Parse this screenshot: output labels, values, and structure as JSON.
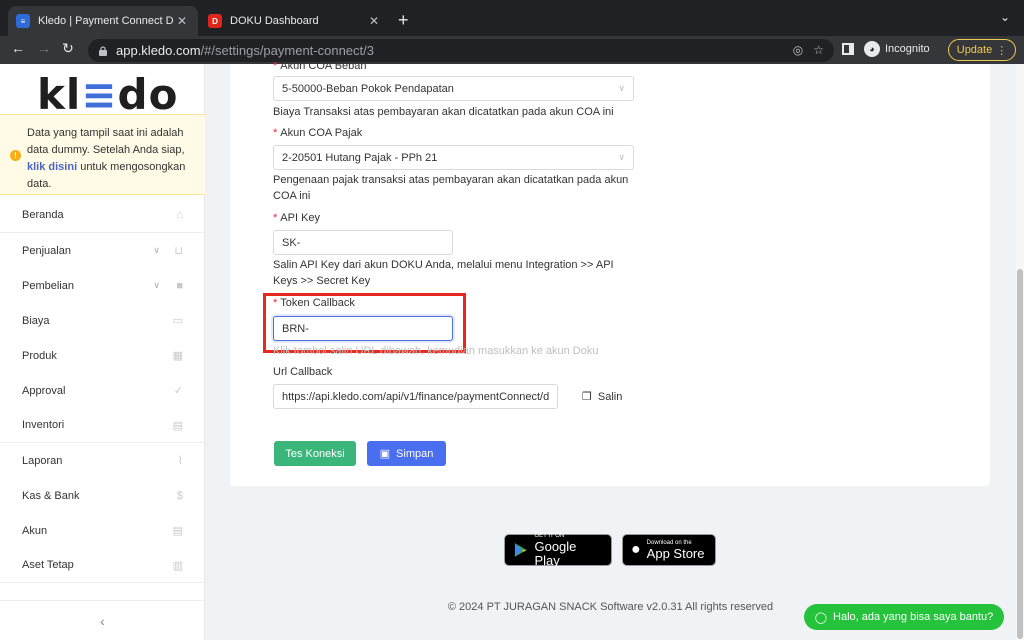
{
  "browser": {
    "tabs": [
      {
        "title": "Kledo | Payment Connect Doku",
        "favicon": "kledo-favicon"
      },
      {
        "title": "DOKU Dashboard",
        "favicon": "doku-favicon"
      }
    ],
    "url_host": "app.kledo.com",
    "url_path": "/#/settings/payment-connect/3",
    "incognito_label": "Incognito",
    "update_label": "Update"
  },
  "sidebar": {
    "logo": "kledo",
    "notice": {
      "text_before": "Data yang tampil saat ini adalah data dummy. Setelah Anda siap, ",
      "link": "klik disini",
      "text_after": " untuk mengosongkan data."
    },
    "items": [
      {
        "label": "Beranda",
        "icon": "home-icon"
      },
      {
        "label": "Penjualan",
        "icon": "basket-icon",
        "expandable": true
      },
      {
        "label": "Pembelian",
        "icon": "bag-icon",
        "expandable": true
      },
      {
        "label": "Biaya",
        "icon": "card-icon"
      },
      {
        "label": "Produk",
        "icon": "box-icon"
      },
      {
        "label": "Approval",
        "icon": "check-icon"
      },
      {
        "label": "Inventori",
        "icon": "warehouse-icon"
      },
      {
        "label": "Laporan",
        "icon": "chart-icon"
      },
      {
        "label": "Kas & Bank",
        "icon": "dollar-icon"
      },
      {
        "label": "Akun",
        "icon": "list-icon"
      },
      {
        "label": "Aset Tetap",
        "icon": "building-icon"
      }
    ]
  },
  "form": {
    "coa_beban": {
      "label": "Akun COA Beban",
      "value": "5-50000-Beban Pokok Pendapatan",
      "help": "Biaya Transaksi atas pembayaran akan dicatatkan pada akun COA ini"
    },
    "coa_pajak": {
      "label": "Akun COA Pajak",
      "value": "2-20501 Hutang Pajak - PPh 21",
      "help": "Pengenaan pajak transaksi atas pembayaran akan dicatatkan pada akun COA ini"
    },
    "api_key": {
      "label": "API Key",
      "value": "SK-",
      "help": "Salin API Key dari akun DOKU Anda, melalui menu Integration >> API Keys >> Secret Key"
    },
    "token_callback": {
      "label": "Token Callback",
      "value": "BRN-",
      "help": "Klik tombol salin URL dibawah, kemudian masukkan ke akun Doku"
    },
    "url_callback": {
      "label": "Url Callback",
      "value": "https://api.kledo.com/api/v1/finance/paymentConnect/d",
      "copy_label": "Salin"
    },
    "test_button": "Tes Koneksi",
    "save_button": "Simpan"
  },
  "footer": {
    "google_play_small": "GET IT ON",
    "google_play_big": "Google Play",
    "app_store_small": "Download on the",
    "app_store_big": "App Store",
    "copyright": "© 2024 PT JURAGAN SNACK Software v2.0.31 All rights reserved"
  },
  "chat_button": "Halo, ada yang bisa saya bantu?",
  "colors": {
    "accent": "#4a6ef0",
    "success": "#3bb67a",
    "highlight": "#e8281d",
    "chat": "#25c33b"
  }
}
